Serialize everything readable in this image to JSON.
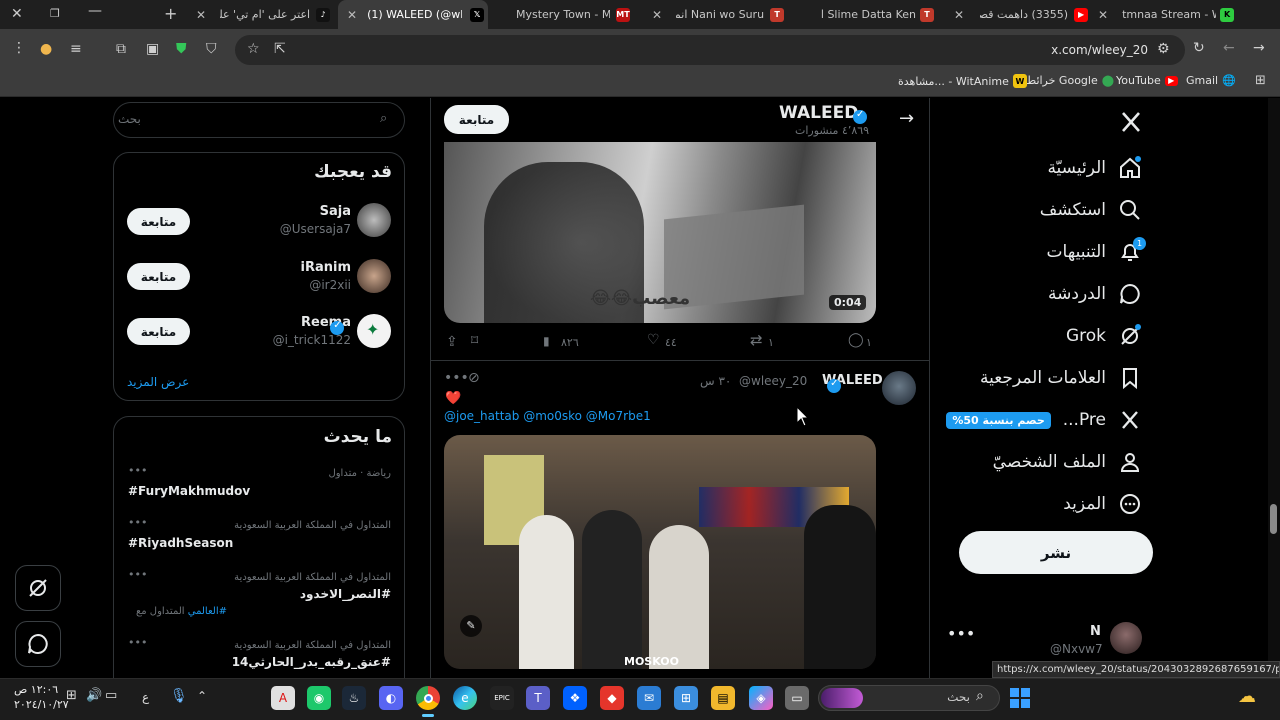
{
  "browser": {
    "tabs": [
      {
        "label": "اعتر على 'ام تي' على",
        "active": false
      },
      {
        "label": "(1) WALEED (@wleey",
        "active": true
      },
      {
        "label": "Mystery Town - MT S",
        "active": false
      },
      {
        "label": "Nani wo Suru انمي",
        "active": false
      },
      {
        "label": "Slime Datta Ken انمي",
        "active": false
      },
      {
        "label": "(3355) داهمت قصر با",
        "active": false
      },
      {
        "label": "tmnaa Stream - Watc",
        "active": false
      }
    ],
    "url": "x.com/wleey_20",
    "bookmarks": [
      {
        "label": "Gmail"
      },
      {
        "label": "YouTube"
      },
      {
        "label": "خرائط Google"
      },
      {
        "label": "مشاهدة... - WitAnime"
      }
    ],
    "status_url": "https://x.com/wleey_20/status/2043032892687659167/photo/1"
  },
  "nav": {
    "items": [
      {
        "label": "الرئيسيّة",
        "icon": "home-icon"
      },
      {
        "label": "استكشف",
        "icon": "search-icon"
      },
      {
        "label": "التنبيهات",
        "icon": "bell-icon"
      },
      {
        "label": "الدردشة",
        "icon": "chat-icon"
      },
      {
        "label": "Grok",
        "icon": "grok-icon"
      },
      {
        "label": "العلامات المرجعية",
        "icon": "bookmark-icon"
      },
      {
        "label": "Pre...",
        "icon": "x-logo-icon"
      },
      {
        "label": "الملف الشخصيّ",
        "icon": "person-icon"
      },
      {
        "label": "المزيد",
        "icon": "more-icon"
      }
    ],
    "notif_count": "1",
    "premium_badge": "%حصم بنسبة 50",
    "post_button": "نشر",
    "account": {
      "name": "N",
      "handle": "@Nxvw7"
    }
  },
  "profile_header": {
    "name": "WALEED",
    "posts_count": "٤٬٨٦٩ منشورات",
    "follow_label": "متابعة"
  },
  "tweet1": {
    "video_duration": "0:04",
    "video_caption": "معصب😂😂",
    "replies": "١",
    "retweets": "١",
    "likes": "٤٤",
    "views": "٨٢٦"
  },
  "tweet2": {
    "name": "WALEED",
    "handle": "@wleey_20",
    "time": "٣٠ س",
    "heart": "❤️",
    "mentions": "@joe_hattab @mo0sko @Mo7rbe1",
    "watermark": "MOSKOO"
  },
  "search": {
    "placeholder": "بحث"
  },
  "suggestions": {
    "title": "قد يعجبك",
    "users": [
      {
        "name": "Saja",
        "handle": "@Usersaja7",
        "verified": false
      },
      {
        "name": "iRanim",
        "handle": "@ir2xii",
        "verified": false
      },
      {
        "name": "Reema",
        "handle": "@i_trick1122",
        "verified": true
      }
    ],
    "follow_label": "متابعة",
    "show_more": "عرض المزيد"
  },
  "trends": {
    "title": "ما يحدث",
    "items": [
      {
        "context": "رياضة · متداول",
        "name": "#FuryMakhmudov",
        "extra": ""
      },
      {
        "context": "المتداول في المملكة العربية السعودية",
        "name": "#RiyadhSeason",
        "extra": ""
      },
      {
        "context": "المتداول في المملكة العربية السعودية",
        "name": "#النصر_الاخدود",
        "extra_prefix": "المتداول مع",
        "extra_tag": "#العالمي"
      },
      {
        "context": "المتداول في المملكة العربية السعودية",
        "name": "#عنق_رقبه_بدر_الحارثي14",
        "extra": ""
      }
    ]
  },
  "taskbar": {
    "search_placeholder": "بحث",
    "time": "١٢:٠٦ ص",
    "date": "٢٠٢٤/١٠/٢٧",
    "lang": "ع"
  },
  "colors": {
    "accent": "#1d9bf0",
    "bg": "#000000",
    "border": "#2f3336",
    "like_red": "#f91880"
  }
}
